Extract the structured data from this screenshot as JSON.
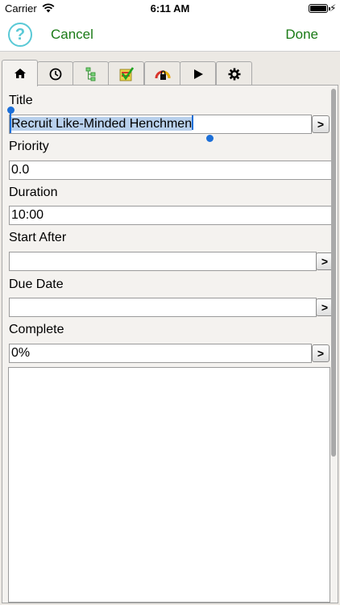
{
  "status_bar": {
    "carrier": "Carrier",
    "time": "6:11 AM"
  },
  "nav": {
    "help": "?",
    "cancel": "Cancel",
    "done": "Done"
  },
  "tabs": [
    {
      "icon": "home-icon",
      "active": true
    },
    {
      "icon": "clock-icon",
      "active": false
    },
    {
      "icon": "hierarchy-icon",
      "active": false
    },
    {
      "icon": "checklist-icon",
      "active": false
    },
    {
      "icon": "lock-gauge-icon",
      "active": false
    },
    {
      "icon": "play-icon",
      "active": false
    },
    {
      "icon": "gear-icon",
      "active": false
    }
  ],
  "form": {
    "title": {
      "label": "Title",
      "value": "Recruit Like-Minded Henchmen",
      "button": ">"
    },
    "priority": {
      "label": "Priority",
      "value": "0.0"
    },
    "duration": {
      "label": "Duration",
      "value": "10:00"
    },
    "start_after": {
      "label": "Start After",
      "value": "",
      "button": ">"
    },
    "due_date": {
      "label": "Due Date",
      "value": "",
      "button": ">"
    },
    "complete": {
      "label": "Complete",
      "value": "0%",
      "button": ">"
    }
  },
  "colors": {
    "accent_green": "#1a7a16",
    "help_cyan": "#59c9d6",
    "selection_blue": "#1c6fd8"
  }
}
